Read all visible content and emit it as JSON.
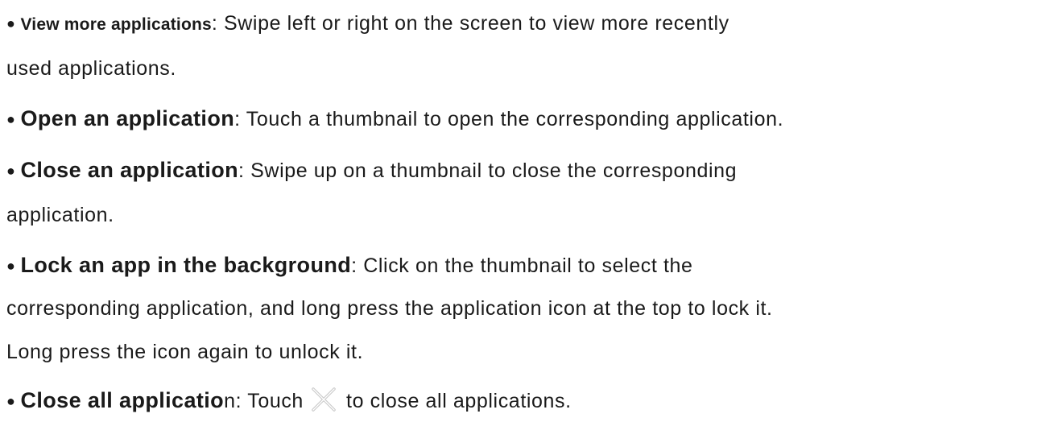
{
  "bullet_symbol": "●",
  "items": [
    {
      "term": "View more applications",
      "desc_line1": ": Swipe left or right on the screen to view more recently",
      "desc_line2": "used applications."
    },
    {
      "term": "Open an application",
      "desc_line1": ": Touch a thumbnail to open the corresponding application."
    },
    {
      "term": "Close an application",
      "desc_line1": ": Swipe up on a thumbnail to close the corresponding",
      "desc_line2": "application."
    },
    {
      "term": "Lock an app in the background",
      "desc_line1": ": Click on the thumbnail to select the",
      "desc_line2": "corresponding application, and long press the application icon at the top to lock it.",
      "desc_line3": "Long press the icon again to unlock it."
    },
    {
      "term_bold": "Close all applicatio",
      "term_rest": "n",
      "desc_before_icon": ": Touch",
      "icon": "close-x-icon",
      "desc_after_icon": "to close all applications."
    }
  ]
}
